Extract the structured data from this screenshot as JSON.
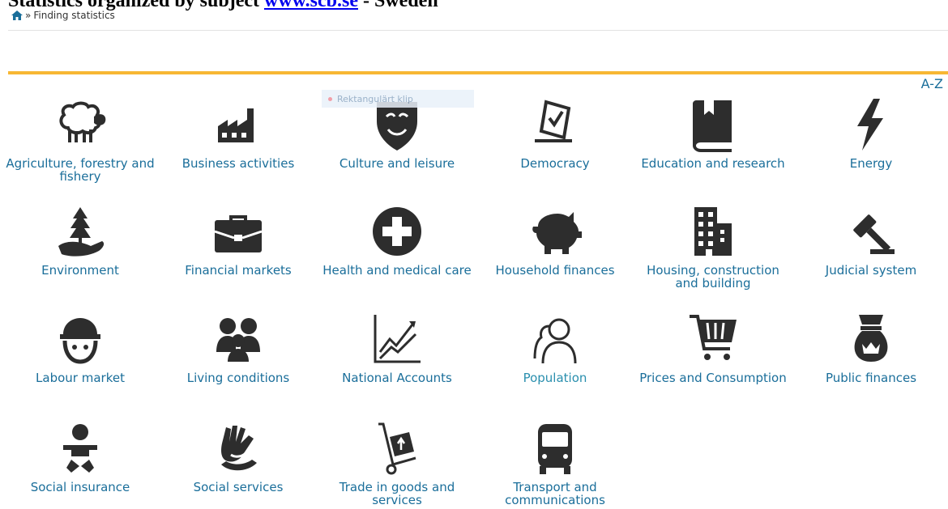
{
  "heading": {
    "prefix": "Statistics organized by subject",
    "link": "www.scb.se",
    "suffix": " - Sweden"
  },
  "breadcrumb": {
    "separator": "»",
    "current": "Finding statistics"
  },
  "az_link": "A-Z",
  "tooltip": "Rektangulärt klip",
  "colors": {
    "accent": "#f7b733",
    "link": "#1a6e9a",
    "icon": "#2d2d2d"
  },
  "categories": [
    {
      "label": "Agriculture, forestry and fishery",
      "icon": "sheep-icon"
    },
    {
      "label": "Business activities",
      "icon": "factory-icon"
    },
    {
      "label": "Culture and leisure",
      "icon": "theatre-mask-icon"
    },
    {
      "label": "Democracy",
      "icon": "ballot-box-icon"
    },
    {
      "label": "Education and research",
      "icon": "book-icon"
    },
    {
      "label": "Energy",
      "icon": "lightning-icon"
    },
    {
      "label": "Environment",
      "icon": "tree-hand-icon"
    },
    {
      "label": "Financial markets",
      "icon": "briefcase-icon"
    },
    {
      "label": "Health and medical care",
      "icon": "medical-cross-icon"
    },
    {
      "label": "Household finances",
      "icon": "piggy-bank-icon"
    },
    {
      "label": "Housing, construction and building",
      "icon": "building-icon"
    },
    {
      "label": "Judicial system",
      "icon": "gavel-icon"
    },
    {
      "label": "Labour market",
      "icon": "hardhat-worker-icon"
    },
    {
      "label": "Living conditions",
      "icon": "people-group-icon"
    },
    {
      "label": "National Accounts",
      "icon": "growth-chart-icon"
    },
    {
      "label": "Population",
      "icon": "people-outline-icon"
    },
    {
      "label": "Prices and Consumption",
      "icon": "shopping-cart-icon"
    },
    {
      "label": "Public finances",
      "icon": "money-bag-icon"
    },
    {
      "label": "Social insurance",
      "icon": "baby-icon"
    },
    {
      "label": "Social services",
      "icon": "helping-hands-icon"
    },
    {
      "label": "Trade in goods and services",
      "icon": "hand-truck-icon"
    },
    {
      "label": "Transport and communications",
      "icon": "bus-icon"
    }
  ]
}
